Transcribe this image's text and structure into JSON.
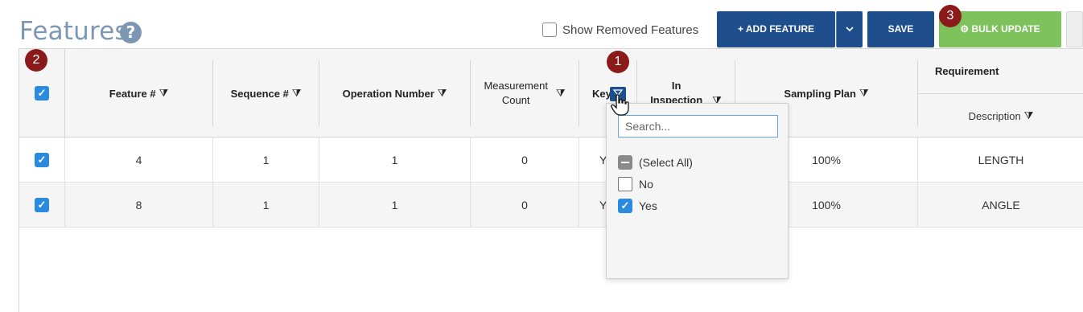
{
  "header": {
    "title": "Features",
    "help_glyph": "?",
    "show_removed_label": "Show Removed Features",
    "add_feature_label": "+ ADD FEATURE",
    "add_caret": "⌄",
    "save_label": "SAVE",
    "bulk_update_label": "⚙ BULK UPDATE"
  },
  "badges": {
    "b1": "1",
    "b2": "2",
    "b3": "3"
  },
  "columns": {
    "feature": "Feature #",
    "sequence": "Sequence #",
    "operation": "Operation Number",
    "measurement_1": "Measurement",
    "measurement_2": "Count",
    "key": "Key",
    "in_inspection_1": "In",
    "in_inspection_2": "Inspection",
    "sampling": "Sampling Plan",
    "requirement": "Requirement",
    "description": "Description",
    "filter_glyph": "⧩"
  },
  "rows": [
    {
      "feature": "4",
      "sequence": "1",
      "operation": "1",
      "measurement": "0",
      "key": "Y",
      "sampling": "100%",
      "description": "LENGTH"
    },
    {
      "feature": "8",
      "sequence": "1",
      "operation": "1",
      "measurement": "0",
      "key": "Y",
      "sampling": "100%",
      "description": "ANGLE"
    }
  ],
  "filter": {
    "search_placeholder": "Search...",
    "options": [
      {
        "label": "(Select All)",
        "state": "indeterminate"
      },
      {
        "label": "No",
        "state": "unchecked"
      },
      {
        "label": "Yes",
        "state": "checked"
      }
    ]
  },
  "colors": {
    "primary": "#1e4f8c",
    "bulk": "#7dc25a",
    "checkbox": "#2a8ae0",
    "badge": "#8b1a1a",
    "title": "#7d97b3"
  },
  "icons": {
    "help": "help-icon",
    "funnel": "filter-icon",
    "gear": "gear-icon",
    "caret": "chevron-down-icon",
    "cursor": "hand-cursor-icon"
  }
}
